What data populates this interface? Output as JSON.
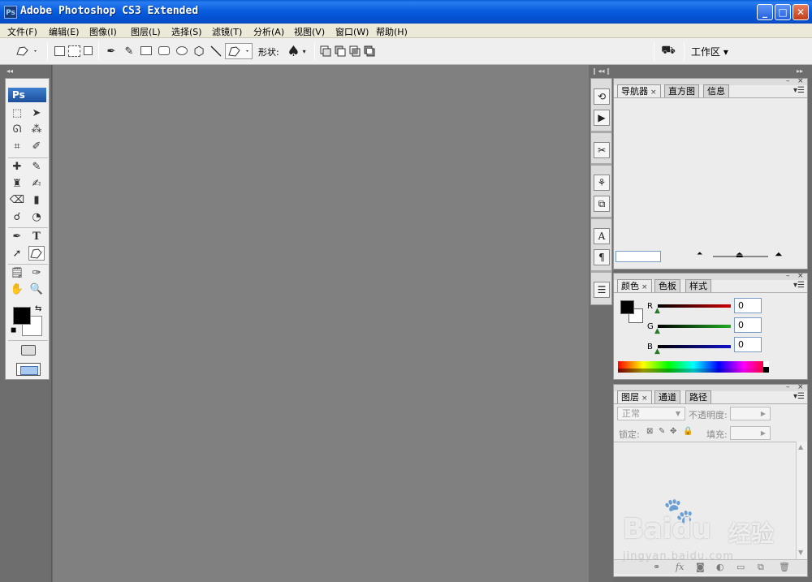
{
  "window": {
    "title": "Adobe Photoshop CS3 Extended",
    "app_icon": "Ps",
    "minimize_glyph": "_",
    "maximize_glyph": "□",
    "close_glyph": "✕"
  },
  "menu": [
    "文件(F)",
    "编辑(E)",
    "图像(I)",
    "图层(L)",
    "选择(S)",
    "滤镜(T)",
    "分析(A)",
    "视图(V)",
    "窗口(W)",
    "帮助(H)"
  ],
  "options_bar": {
    "shape_label": "形状:",
    "workspace_label": "工作区 ▾",
    "tool_icon": "custom-shape-icon"
  },
  "toolbox": {
    "logo": "Ps",
    "collapse": "◂◂",
    "type_tool_glyph": "T"
  },
  "dock": {
    "collapse_left": "‖ ◂◂ ‖",
    "collapse_right": "▸▸"
  },
  "panels": {
    "navigator": {
      "tabs": [
        {
          "label": "导航器",
          "active": true,
          "close": "×"
        },
        {
          "label": "直方图",
          "active": false
        },
        {
          "label": "信息",
          "active": false
        }
      ]
    },
    "color": {
      "tabs": [
        {
          "label": "颜色",
          "active": true,
          "close": "×"
        },
        {
          "label": "色板",
          "active": false
        },
        {
          "label": "样式",
          "active": false
        }
      ],
      "channels": [
        {
          "label": "R",
          "value": "0",
          "color": "#cc0000"
        },
        {
          "label": "G",
          "value": "0",
          "color": "#22aa22"
        },
        {
          "label": "B",
          "value": "0",
          "color": "#1111cc"
        }
      ]
    },
    "layers": {
      "tabs": [
        {
          "label": "图层",
          "active": true,
          "close": "×"
        },
        {
          "label": "通道",
          "active": false
        },
        {
          "label": "路径",
          "active": false
        }
      ],
      "blend_mode": "正常",
      "opacity_label": "不透明度:",
      "lock_label": "锁定:",
      "fill_label": "填充:"
    }
  },
  "watermark": {
    "brand": "Bai",
    "brand2": "du",
    "cn": "经验",
    "url": "jingyan.baidu.com"
  }
}
